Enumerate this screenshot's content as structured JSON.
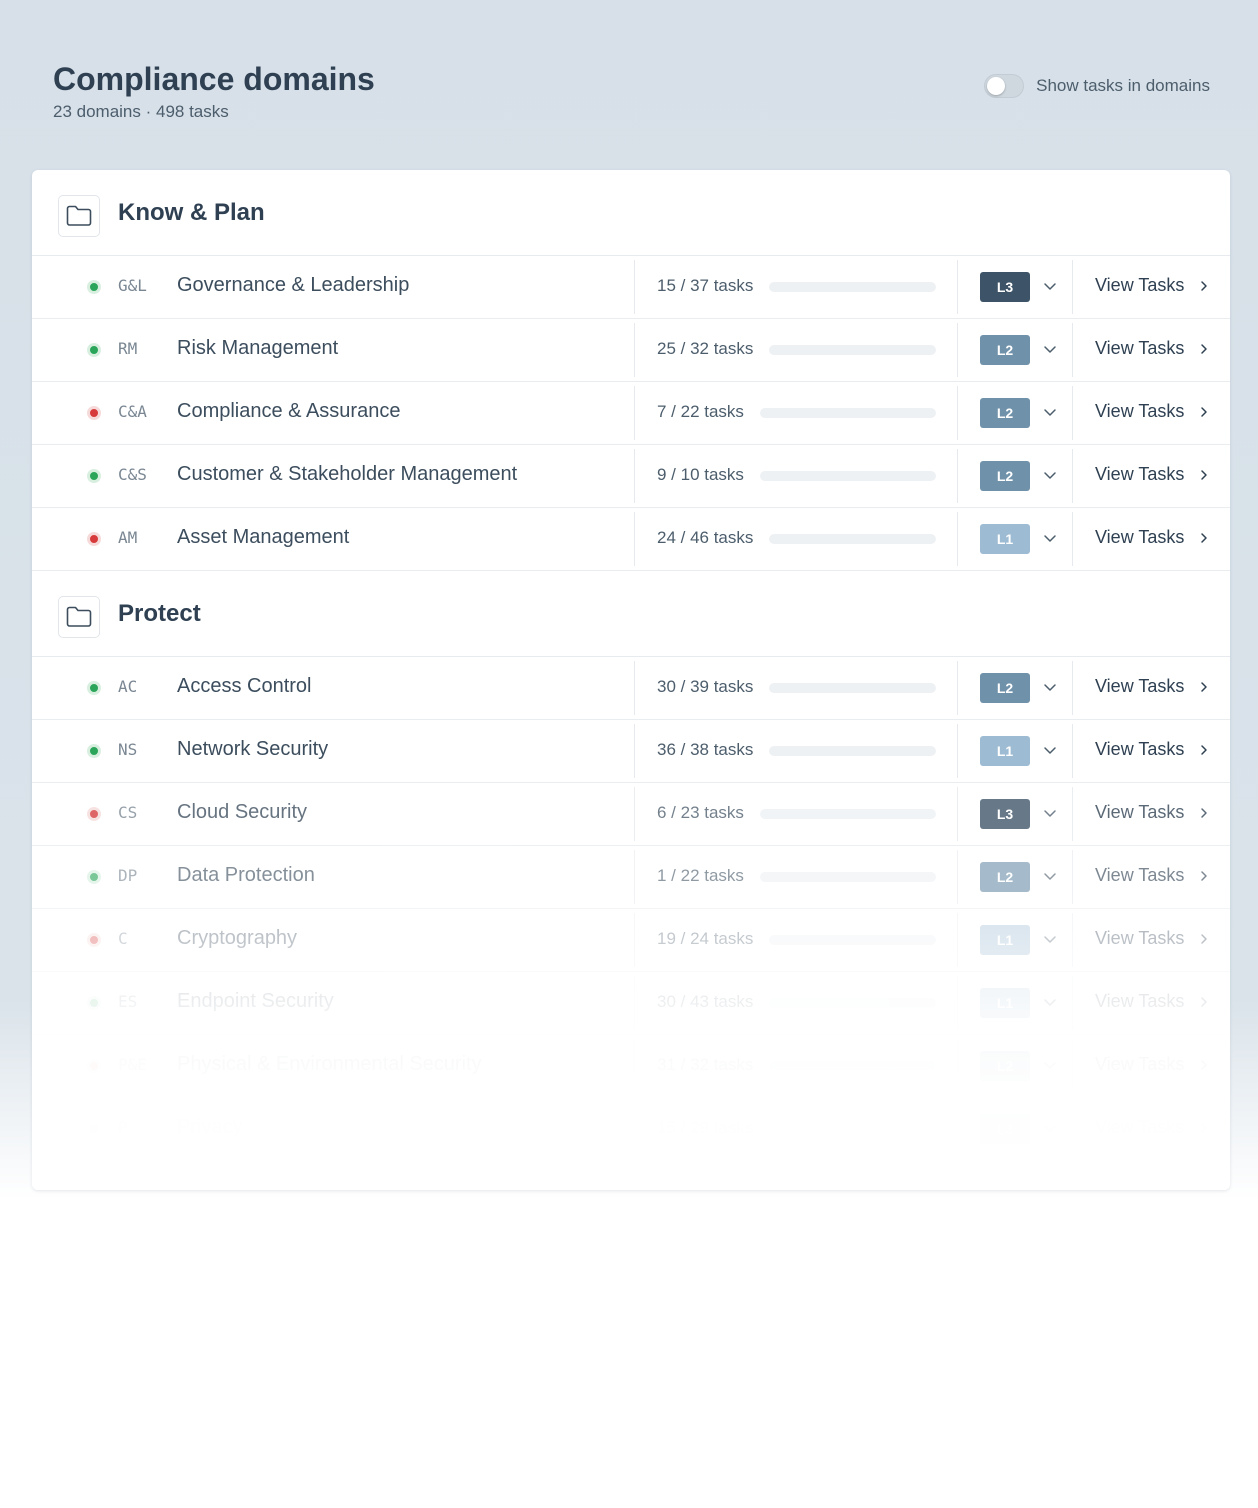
{
  "header": {
    "title": "Compliance domains",
    "subtitle": "23 domains · 498 tasks",
    "toggle_label": "Show tasks in domains"
  },
  "view_label": "View Tasks",
  "groups": [
    {
      "title": "Know & Plan",
      "rows": [
        {
          "status": "green",
          "code": "G&L",
          "name": "Governance & Leadership",
          "count": "15 / 37 tasks",
          "done": 15,
          "total": 37,
          "level": "L3"
        },
        {
          "status": "green",
          "code": "RM",
          "name": "Risk Management",
          "count": "25 / 32 tasks",
          "done": 25,
          "total": 32,
          "level": "L2"
        },
        {
          "status": "red",
          "code": "C&A",
          "name": "Compliance & Assurance",
          "count": "7 / 22 tasks",
          "done": 7,
          "total": 22,
          "level": "L2"
        },
        {
          "status": "green",
          "code": "C&S",
          "name": "Customer & Stakeholder Management",
          "count": "9 / 10 tasks",
          "done": 9,
          "total": 10,
          "level": "L2"
        },
        {
          "status": "red",
          "code": "AM",
          "name": "Asset Management",
          "count": "24 / 46 tasks",
          "done": 24,
          "total": 46,
          "level": "L1"
        }
      ]
    },
    {
      "title": "Protect",
      "rows": [
        {
          "status": "green",
          "code": "AC",
          "name": "Access Control",
          "count": "30 / 39 tasks",
          "done": 30,
          "total": 39,
          "level": "L2"
        },
        {
          "status": "green",
          "code": "NS",
          "name": "Network Security",
          "count": "36 / 38 tasks",
          "done": 36,
          "total": 38,
          "level": "L1"
        },
        {
          "status": "red",
          "code": "CS",
          "name": "Cloud Security",
          "count": "6 / 23 tasks",
          "done": 6,
          "total": 23,
          "level": "L3"
        },
        {
          "status": "green",
          "code": "DP",
          "name": "Data Protection",
          "count": "1 / 22 tasks",
          "done": 1,
          "total": 22,
          "level": "L2"
        },
        {
          "status": "red",
          "code": "C",
          "name": "Cryptography",
          "count": "19 / 24 tasks",
          "done": 19,
          "total": 24,
          "level": "L1"
        },
        {
          "status": "green",
          "code": "ES",
          "name": "Endpoint Security",
          "count": "30 / 43 tasks",
          "done": 30,
          "total": 43,
          "level": "L1"
        },
        {
          "status": "red",
          "code": "P&E",
          "name": "Physical & Environmental Security",
          "count": "31 / 32 tasks",
          "done": 31,
          "total": 32,
          "level": "L2"
        },
        {
          "status": "red",
          "code": "P",
          "name": "Privacy",
          "count": "15 / 29 tasks",
          "done": 15,
          "total": 29,
          "level": "L3"
        }
      ]
    }
  ]
}
